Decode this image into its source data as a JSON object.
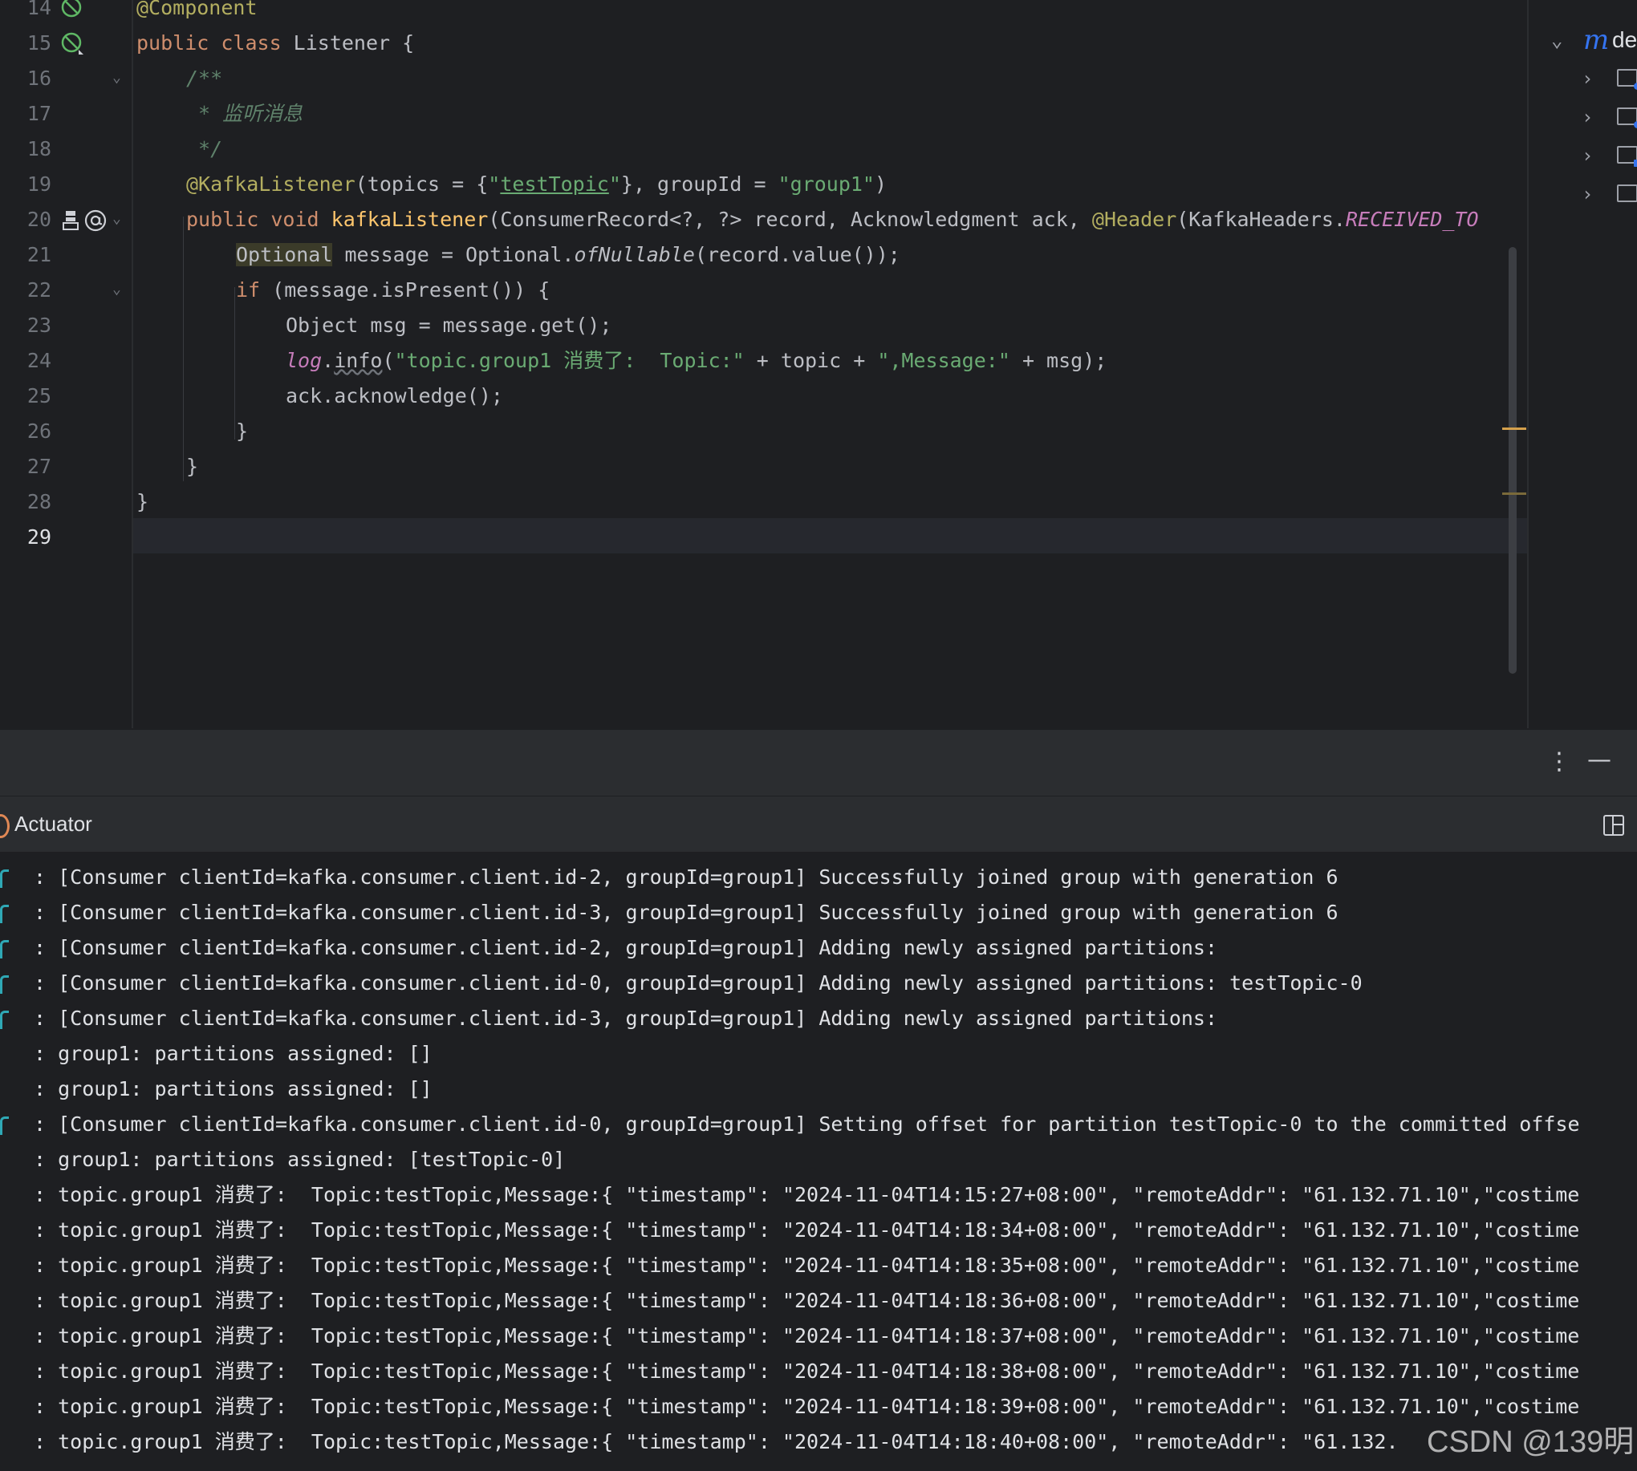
{
  "editor": {
    "lines": [
      {
        "n": "14",
        "code": "@Component"
      },
      {
        "n": "15",
        "code": "public class Listener {"
      },
      {
        "n": "16",
        "code": "    /**"
      },
      {
        "n": "17",
        "code": "     * 监听消息"
      },
      {
        "n": "18",
        "code": "     */"
      },
      {
        "n": "19",
        "code": "    @KafkaListener(topics = {\"testTopic\"}, groupId = \"group1\")"
      },
      {
        "n": "20",
        "code": "    public void kafkaListener(ConsumerRecord<?, ?> record, Acknowledgment ack, @Header(KafkaHeaders.RECEIVED_TO"
      },
      {
        "n": "21",
        "code": "        Optional message = Optional.ofNullable(record.value());"
      },
      {
        "n": "22",
        "code": "        if (message.isPresent()) {"
      },
      {
        "n": "23",
        "code": "            Object msg = message.get();"
      },
      {
        "n": "24",
        "code": "            log.info(\"topic.group1 消费了:  Topic:\" + topic + \",Message:\" + msg);"
      },
      {
        "n": "25",
        "code": "            ack.acknowledge();"
      },
      {
        "n": "26",
        "code": "        }"
      },
      {
        "n": "27",
        "code": "    }"
      },
      {
        "n": "28",
        "code": "}"
      },
      {
        "n": "29",
        "code": ""
      }
    ],
    "tokens": {
      "l14": "@Component",
      "l15_kw": "public class",
      "l15_rest": " Listener {",
      "l16": "/**",
      "l17": " * 监听消息",
      "l18": " */",
      "l19_an": "@KafkaListener",
      "l19_a": "(topics = {",
      "l19_q1": "\"",
      "l19_topic": "testTopic",
      "l19_q2": "\"",
      "l19_b": "}, groupId = ",
      "l19_grp": "\"group1\"",
      "l19_c": ")",
      "l20_kw": "public void",
      "l20_fn": "kafkaListener",
      "l20_a": "(ConsumerRecord<?, ?> record, Acknowledgment ack, ",
      "l20_an": "@Header",
      "l20_b": "(KafkaHeaders.",
      "l20_st": "RECEIVED_TO",
      "l21_type": "Optional",
      "l21_a": " message = Optional.",
      "l21_it": "ofNullable",
      "l21_b": "(record.value());",
      "l22_kw": "if",
      "l22_a": " (message.isPresent()) {",
      "l23": "Object msg = message.get();",
      "l24_st": "log",
      "l24_dot": ".",
      "l24_info": "info",
      "l24_a": "(",
      "l24_s1": "\"topic.group1 消费了:  Topic:\"",
      "l24_b": " + topic + ",
      "l24_s2": "\",Message:\"",
      "l24_c": " + msg);",
      "l25": "ack.acknowledge();",
      "l26": "}",
      "l27": "}",
      "l28": "}"
    }
  },
  "structure": {
    "root_label": "de",
    "root_icon": "m"
  },
  "toolwindow": {
    "more_icon": "⋮",
    "minimize_icon": "—",
    "tab_title": "Actuator"
  },
  "console": {
    "lines": [
      {
        "marker": true,
        "text": ": [Consumer clientId=kafka.consumer.client.id-2, groupId=group1] Successfully joined group with generation 6"
      },
      {
        "marker": true,
        "text": ": [Consumer clientId=kafka.consumer.client.id-3, groupId=group1] Successfully joined group with generation 6"
      },
      {
        "marker": true,
        "text": ": [Consumer clientId=kafka.consumer.client.id-2, groupId=group1] Adding newly assigned partitions:"
      },
      {
        "marker": true,
        "text": ": [Consumer clientId=kafka.consumer.client.id-0, groupId=group1] Adding newly assigned partitions: testTopic-0"
      },
      {
        "marker": true,
        "text": ": [Consumer clientId=kafka.consumer.client.id-3, groupId=group1] Adding newly assigned partitions:"
      },
      {
        "marker": false,
        "text": ": group1: partitions assigned: []"
      },
      {
        "marker": false,
        "text": ": group1: partitions assigned: []"
      },
      {
        "marker": true,
        "text": ": [Consumer clientId=kafka.consumer.client.id-0, groupId=group1] Setting offset for partition testTopic-0 to the committed offse"
      },
      {
        "marker": false,
        "text": ": group1: partitions assigned: [testTopic-0]"
      },
      {
        "marker": false,
        "text": ": topic.group1 消费了:  Topic:testTopic,Message:{ \"timestamp\": \"2024-11-04T14:15:27+08:00\", \"remoteAddr\": \"61.132.71.10\",\"costime"
      },
      {
        "marker": false,
        "text": ": topic.group1 消费了:  Topic:testTopic,Message:{ \"timestamp\": \"2024-11-04T14:18:34+08:00\", \"remoteAddr\": \"61.132.71.10\",\"costime"
      },
      {
        "marker": false,
        "text": ": topic.group1 消费了:  Topic:testTopic,Message:{ \"timestamp\": \"2024-11-04T14:18:35+08:00\", \"remoteAddr\": \"61.132.71.10\",\"costime"
      },
      {
        "marker": false,
        "text": ": topic.group1 消费了:  Topic:testTopic,Message:{ \"timestamp\": \"2024-11-04T14:18:36+08:00\", \"remoteAddr\": \"61.132.71.10\",\"costime"
      },
      {
        "marker": false,
        "text": ": topic.group1 消费了:  Topic:testTopic,Message:{ \"timestamp\": \"2024-11-04T14:18:37+08:00\", \"remoteAddr\": \"61.132.71.10\",\"costime"
      },
      {
        "marker": false,
        "text": ": topic.group1 消费了:  Topic:testTopic,Message:{ \"timestamp\": \"2024-11-04T14:18:38+08:00\", \"remoteAddr\": \"61.132.71.10\",\"costime"
      },
      {
        "marker": false,
        "text": ": topic.group1 消费了:  Topic:testTopic,Message:{ \"timestamp\": \"2024-11-04T14:18:39+08:00\", \"remoteAddr\": \"61.132.71.10\",\"costime"
      },
      {
        "marker": false,
        "text": ": topic.group1 消费了:  Topic:testTopic,Message:{ \"timestamp\": \"2024-11-04T14:18:40+08:00\", \"remoteAddr\": \"61.132."
      }
    ]
  },
  "watermark": "CSDN @139明",
  "colors": {
    "background": "#1e1f22",
    "panel": "#2b2d30",
    "keyword": "#cf8e6d",
    "annotation": "#b3ae60",
    "string": "#6aab73",
    "function": "#56a8f5",
    "static_field": "#c77dbb",
    "comment": "#5f826b",
    "log_marker": "#2fa8b5"
  }
}
